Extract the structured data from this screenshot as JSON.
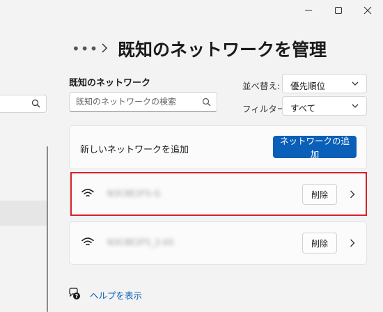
{
  "window": {
    "minimize_icon": "minimize-icon",
    "maximize_icon": "maximize-icon",
    "close_icon": "close-icon"
  },
  "breadcrumb": {
    "more": "•••",
    "title": "既知のネットワークを管理"
  },
  "known_networks": {
    "section_title": "既知のネットワーク",
    "search_placeholder": "既知のネットワークの検索",
    "sort_label": "並べ替え:",
    "sort_value": "優先順位",
    "filter_label": "フィルター:",
    "filter_value": "すべて",
    "add_label": "新しいネットワークを追加",
    "add_button": "ネットワークの追加",
    "networks": [
      {
        "ssid": "N3C8E2F5-G",
        "delete_label": "削除",
        "icon": "wifi-icon"
      },
      {
        "ssid": "N3C8E2F5_2-A5",
        "delete_label": "削除",
        "icon": "wifi-icon"
      }
    ]
  },
  "help": {
    "label": "ヘルプを表示",
    "icon": "help-chat-icon"
  },
  "colors": {
    "accent": "#0a5fb8",
    "highlight": "#d8202c",
    "background": "#f3f3f3"
  }
}
